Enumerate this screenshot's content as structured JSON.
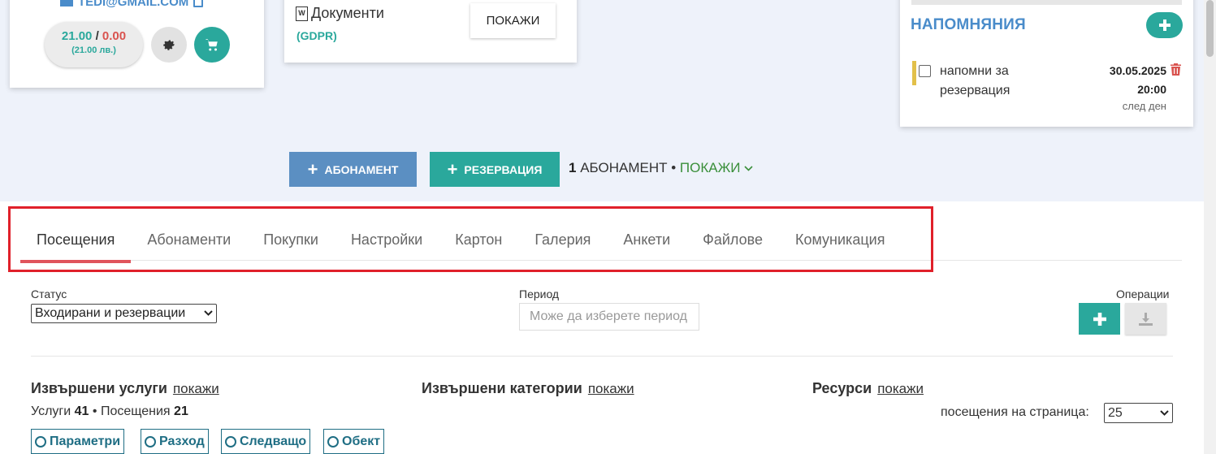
{
  "client": {
    "email": "TEDI@GMAIL.COM",
    "balance_positive": "21.00",
    "balance_separator": "/",
    "balance_negative": "0.00",
    "balance_currency_note": "(21.00 лв.)"
  },
  "documents": {
    "title": "Документи",
    "subtitle": "(GDPR)",
    "show_label": "ПОКАЖИ"
  },
  "reminders": {
    "title": "НАПОМНЯНИЯ",
    "items": [
      {
        "text": "напомни за резервация",
        "date": "30.05.2025",
        "time": "20:00",
        "relative": "след ден"
      }
    ]
  },
  "actions": {
    "subscription_label": "АБОНАМЕНТ",
    "reservation_label": "РЕЗЕРВАЦИЯ",
    "summary_count": "1",
    "summary_text": "АБОНАМЕНТ •",
    "summary_show": "ПОКАЖИ"
  },
  "tabs": [
    {
      "label": "Посещения",
      "active": true
    },
    {
      "label": "Абонаменти",
      "active": false
    },
    {
      "label": "Покупки",
      "active": false
    },
    {
      "label": "Настройки",
      "active": false
    },
    {
      "label": "Картон",
      "active": false
    },
    {
      "label": "Галерия",
      "active": false
    },
    {
      "label": "Анкети",
      "active": false
    },
    {
      "label": "Файлове",
      "active": false
    },
    {
      "label": "Комуникация",
      "active": false
    }
  ],
  "filters": {
    "status_label": "Статус",
    "status_value": "Входирани и резервации",
    "period_label": "Период",
    "period_placeholder": "Може да изберете период",
    "operations_label": "Операции"
  },
  "sections": {
    "services_title": "Извършени услуги",
    "categories_title": "Извършени категории",
    "resources_title": "Ресурси",
    "show_link": "покажи"
  },
  "stats": {
    "services_label": "Услуги",
    "services_count": "41",
    "separator": "•",
    "visits_label": "Посещения",
    "visits_count": "21"
  },
  "pagination": {
    "label": "посещения на страница:",
    "value": "25"
  },
  "toggles": [
    "Параметри",
    "Разход",
    "Следващо",
    "Обект"
  ],
  "colors": {
    "teal": "#2aa89c",
    "blue": "#4a8cca",
    "danger": "#d9534f",
    "highlight_frame": "#e0202a"
  }
}
